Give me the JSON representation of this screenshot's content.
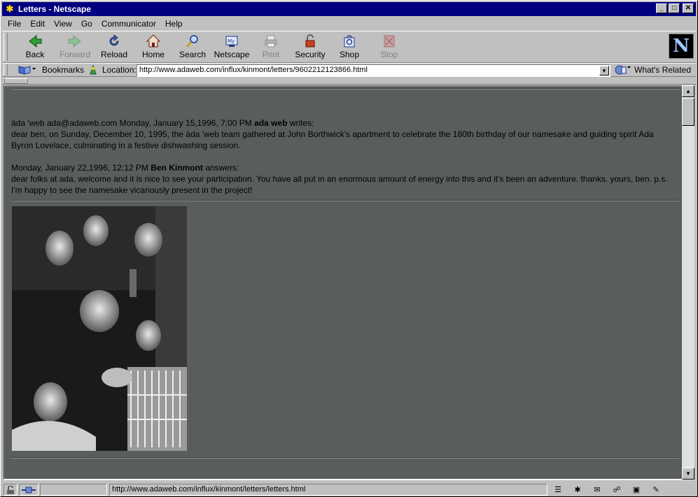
{
  "window": {
    "title": "Letters - Netscape",
    "controls": {
      "minimize": "_",
      "maximize": "□",
      "close": "✕"
    }
  },
  "menu": [
    {
      "label": "File"
    },
    {
      "label": "Edit"
    },
    {
      "label": "View"
    },
    {
      "label": "Go"
    },
    {
      "label": "Communicator"
    },
    {
      "label": "Help"
    }
  ],
  "toolbar": {
    "back": "Back",
    "forward": "Forward",
    "reload": "Reload",
    "home": "Home",
    "search": "Search",
    "netscape": "Netscape",
    "print": "Print",
    "security": "Security",
    "shop": "Shop",
    "stop": "Stop",
    "logo": "N"
  },
  "location": {
    "bookmarks_label": "Bookmarks",
    "location_label": "Location:",
    "url": "http://www.adaweb.com/influx/kinmont/letters/9602212123866.html",
    "whats_related": "What's Related"
  },
  "letter1": {
    "sender_prefix": "äda 'web ada@adaweb.com Monday, January 15,1996, 7:00 PM ",
    "sender_name": "ada web",
    "sender_suffix": " writes:",
    "body": "dear ben, on Sunday, December 10, 1995, the äda 'web team gathered at John Borthwick's apartment to celebrate the 180th birthday of our namesake and guiding spirit Ada Byron Lovelace, culminating in a festive dishwashing session."
  },
  "letter2": {
    "date_prefix": "Monday, January 22,1996, 12:12 PM ",
    "author": "Ben Kinmont",
    "suffix": " answers:",
    "body": "dear folks at ada, welcome and it is nice to see your participation. You have all put in an enormous amount of energy into this and it's been an adventure. thanks. yours, ben. p.s. I'm happy to see the namesake vicariously present in the project!"
  },
  "statusbar": {
    "url": "http://www.adaweb.com/influx/kinmont/letters/letters.html"
  }
}
